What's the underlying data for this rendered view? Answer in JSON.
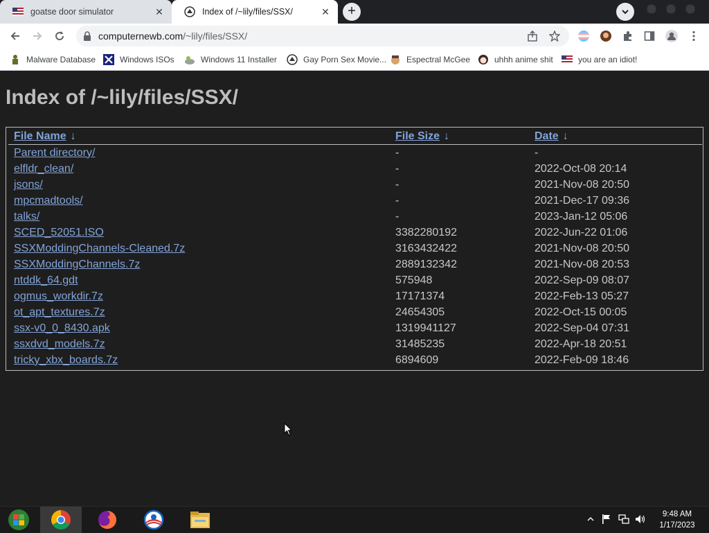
{
  "browser": {
    "tabs": [
      {
        "title": "goatse door simulator",
        "favicon": "flag-icon",
        "close": "✕"
      },
      {
        "title": "Index of /~lily/files/SSX/",
        "favicon": "fileserver-icon",
        "close": "✕"
      }
    ],
    "new_tab": "+",
    "address": {
      "host": "computernewb.com",
      "path": "/~lily/files/SSX/"
    }
  },
  "bookmarks": [
    {
      "label": "Malware Database",
      "icon": "malware-icon"
    },
    {
      "label": "Windows ISOs",
      "icon": "windows-x-icon"
    },
    {
      "label": "Windows 11 Installer",
      "icon": "installer-icon"
    },
    {
      "label": "Gay Porn Sex Movie...",
      "icon": "fileserver-icon"
    },
    {
      "label": "Espectral McGee",
      "icon": "face-icon"
    },
    {
      "label": "uhhh anime shit",
      "icon": "anime-icon"
    },
    {
      "label": "you are an idiot!",
      "icon": "flag-icon"
    }
  ],
  "page": {
    "title": "Index of /~lily/files/SSX/",
    "columns": {
      "name": "File Name",
      "size": "File Size",
      "date": "Date",
      "sort_arrow": "↓"
    },
    "rows": [
      {
        "name": "Parent directory/",
        "size": "-",
        "date": "-"
      },
      {
        "name": "elfldr_clean/",
        "size": "-",
        "date": "2022-Oct-08 20:14"
      },
      {
        "name": "jsons/",
        "size": "-",
        "date": "2021-Nov-08 20:50"
      },
      {
        "name": "mpcmadtools/",
        "size": "-",
        "date": "2021-Dec-17 09:36"
      },
      {
        "name": "talks/",
        "size": "-",
        "date": "2023-Jan-12 05:06"
      },
      {
        "name": "SCED_52051.ISO",
        "size": "3382280192",
        "date": "2022-Jun-22 01:06"
      },
      {
        "name": "SSXModdingChannels-Cleaned.7z",
        "size": "3163432422",
        "date": "2021-Nov-08 20:50"
      },
      {
        "name": "SSXModdingChannels.7z",
        "size": "2889132342",
        "date": "2021-Nov-08 20:53"
      },
      {
        "name": "ntddk_64.gdt",
        "size": "575948",
        "date": "2022-Sep-09 08:07"
      },
      {
        "name": "ogmus_workdir.7z",
        "size": "17171374",
        "date": "2022-Feb-13 05:27"
      },
      {
        "name": "ot_apt_textures.7z",
        "size": "24654305",
        "date": "2022-Oct-15 00:05"
      },
      {
        "name": "ssx-v0_0_8430.apk",
        "size": "1319941127",
        "date": "2022-Sep-04 07:31"
      },
      {
        "name": "ssxdvd_models.7z",
        "size": "31485235",
        "date": "2022-Apr-18 20:51"
      },
      {
        "name": "tricky_xbx_boards.7z",
        "size": "6894609",
        "date": "2022-Feb-09 18:46"
      }
    ]
  },
  "taskbar": {
    "apps": [
      "start-orb-icon",
      "chrome-icon",
      "firefox-icon",
      "obama-icon",
      "file-explorer-icon"
    ],
    "clock": {
      "time": "9:48 AM",
      "date": "1/17/2023"
    }
  },
  "colors": {
    "link": "#82a4d8",
    "page_bg": "#1e1e1e",
    "heading": "#bdbdbd"
  }
}
